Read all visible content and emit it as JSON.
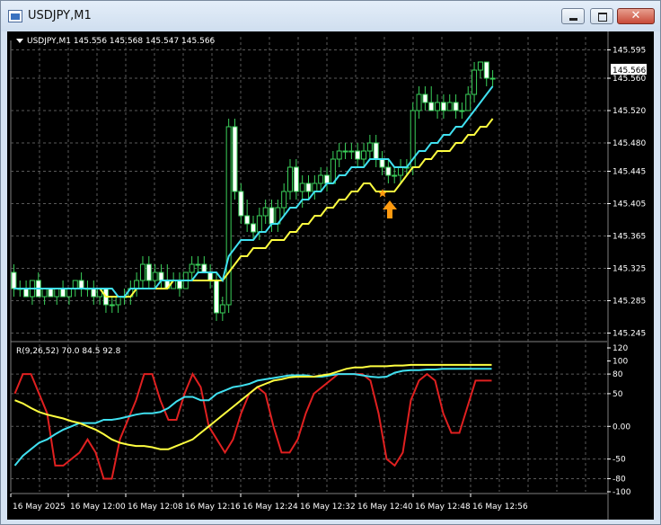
{
  "window": {
    "title": "USDJPY,M1"
  },
  "header": {
    "symbol_info": "USDJPY,M1  145.556 145.568 145.547 145.566"
  },
  "current_price_label": "145.566",
  "indicator_label": "R(9,26,52) 70.0 84.5 92.8",
  "colors": {
    "background": "#000000",
    "grid": "#5a5a5a",
    "candle_up": "#3ad05a",
    "candle_down": "#3ad05a",
    "ma_fast": "#40e0f0",
    "ma_slow": "#ffff40",
    "rsi_fast": "#e02020",
    "rsi_mid": "#40e0f0",
    "rsi_slow": "#ffff40",
    "signal_arrow": "#ff9a10"
  },
  "icons": [
    "app-icon",
    "minimize-icon",
    "maximize-icon",
    "close-icon",
    "dropdown-triangle-icon",
    "up-arrow-icon",
    "star-icon"
  ],
  "chart_data": [
    {
      "type": "candlestick",
      "title": "USDJPY,M1",
      "ylim": [
        145.24,
        145.6
      ],
      "y_ticks": [
        "145.595",
        "145.560",
        "145.520",
        "145.480",
        "145.445",
        "145.405",
        "145.365",
        "145.325",
        "145.285",
        "145.245"
      ],
      "x_labels": [
        "16 May 2025",
        "16 May 12:00",
        "16 May 12:08",
        "16 May 12:16",
        "16 May 12:24",
        "16 May 12:32",
        "16 May 12:40",
        "16 May 12:48",
        "16 May 12:56"
      ],
      "candles": [
        [
          145.32,
          145.33,
          145.29,
          145.3
        ],
        [
          145.3,
          145.31,
          145.29,
          145.3
        ],
        [
          145.3,
          145.31,
          145.29,
          145.29
        ],
        [
          145.29,
          145.31,
          145.28,
          145.31
        ],
        [
          145.31,
          145.32,
          145.29,
          145.29
        ],
        [
          145.29,
          145.3,
          145.28,
          145.3
        ],
        [
          145.3,
          145.3,
          145.29,
          145.29
        ],
        [
          145.29,
          145.3,
          145.28,
          145.3
        ],
        [
          145.3,
          145.31,
          145.29,
          145.29
        ],
        [
          145.29,
          145.3,
          145.28,
          145.3
        ],
        [
          145.3,
          145.31,
          145.29,
          145.31
        ],
        [
          145.31,
          145.32,
          145.29,
          145.3
        ],
        [
          145.3,
          145.31,
          145.29,
          145.3
        ],
        [
          145.3,
          145.31,
          145.28,
          145.29
        ],
        [
          145.29,
          145.3,
          145.28,
          145.3
        ],
        [
          145.3,
          145.3,
          145.27,
          145.28
        ],
        [
          145.28,
          145.29,
          145.27,
          145.28
        ],
        [
          145.28,
          145.29,
          145.27,
          145.29
        ],
        [
          145.29,
          145.3,
          145.28,
          145.29
        ],
        [
          145.29,
          145.31,
          145.28,
          145.3
        ],
        [
          145.3,
          145.32,
          145.29,
          145.31
        ],
        [
          145.31,
          145.34,
          145.3,
          145.33
        ],
        [
          145.33,
          145.34,
          145.3,
          145.31
        ],
        [
          145.31,
          145.33,
          145.3,
          145.32
        ],
        [
          145.32,
          145.33,
          145.3,
          145.31
        ],
        [
          145.31,
          145.33,
          145.3,
          145.3
        ],
        [
          145.3,
          145.32,
          145.3,
          145.31
        ],
        [
          145.31,
          145.32,
          145.29,
          145.3
        ],
        [
          145.3,
          145.32,
          145.3,
          145.32
        ],
        [
          145.32,
          145.34,
          145.31,
          145.33
        ],
        [
          145.33,
          145.34,
          145.32,
          145.33
        ],
        [
          145.33,
          145.34,
          145.32,
          145.32
        ],
        [
          145.32,
          145.33,
          145.3,
          145.31
        ],
        [
          145.31,
          145.32,
          145.26,
          145.27
        ],
        [
          145.27,
          145.29,
          145.26,
          145.28
        ],
        [
          145.28,
          145.51,
          145.27,
          145.5
        ],
        [
          145.5,
          145.51,
          145.41,
          145.42
        ],
        [
          145.42,
          145.43,
          145.38,
          145.39
        ],
        [
          145.39,
          145.41,
          145.37,
          145.38
        ],
        [
          145.38,
          145.39,
          145.36,
          145.37
        ],
        [
          145.37,
          145.4,
          145.36,
          145.39
        ],
        [
          145.39,
          145.41,
          145.38,
          145.4
        ],
        [
          145.4,
          145.41,
          145.37,
          145.38
        ],
        [
          145.38,
          145.41,
          145.37,
          145.4
        ],
        [
          145.4,
          145.43,
          145.39,
          145.42
        ],
        [
          145.42,
          145.46,
          145.41,
          145.45
        ],
        [
          145.45,
          145.46,
          145.41,
          145.42
        ],
        [
          145.42,
          145.44,
          145.4,
          145.43
        ],
        [
          145.43,
          145.44,
          145.41,
          145.42
        ],
        [
          145.42,
          145.44,
          145.41,
          145.43
        ],
        [
          145.43,
          145.45,
          145.42,
          145.44
        ],
        [
          145.44,
          145.45,
          145.42,
          145.43
        ],
        [
          145.43,
          145.47,
          145.43,
          145.46
        ],
        [
          145.46,
          145.48,
          145.45,
          145.47
        ],
        [
          145.47,
          145.48,
          145.46,
          145.47
        ],
        [
          145.47,
          145.48,
          145.46,
          145.47
        ],
        [
          145.47,
          145.48,
          145.45,
          145.46
        ],
        [
          145.46,
          145.48,
          145.45,
          145.47
        ],
        [
          145.47,
          145.49,
          145.46,
          145.48
        ],
        [
          145.48,
          145.49,
          145.45,
          145.46
        ],
        [
          145.46,
          145.47,
          145.44,
          145.45
        ],
        [
          145.45,
          145.46,
          145.43,
          145.44
        ],
        [
          145.44,
          145.45,
          145.43,
          145.44
        ],
        [
          145.44,
          145.46,
          145.43,
          145.45
        ],
        [
          145.45,
          145.46,
          145.44,
          145.45
        ],
        [
          145.45,
          145.53,
          145.44,
          145.52
        ],
        [
          145.52,
          145.55,
          145.51,
          145.54
        ],
        [
          145.54,
          145.55,
          145.52,
          145.53
        ],
        [
          145.53,
          145.55,
          145.52,
          145.52
        ],
        [
          145.52,
          145.54,
          145.51,
          145.53
        ],
        [
          145.53,
          145.54,
          145.51,
          145.52
        ],
        [
          145.52,
          145.54,
          145.52,
          145.53
        ],
        [
          145.53,
          145.54,
          145.51,
          145.52
        ],
        [
          145.52,
          145.53,
          145.51,
          145.52
        ],
        [
          145.52,
          145.55,
          145.52,
          145.54
        ],
        [
          145.54,
          145.58,
          145.53,
          145.57
        ],
        [
          145.57,
          145.58,
          145.56,
          145.58
        ],
        [
          145.58,
          145.58,
          145.55,
          145.56
        ],
        [
          145.56,
          145.57,
          145.55,
          145.56
        ]
      ],
      "ma_fast": [
        145.3,
        145.3,
        145.3,
        145.3,
        145.3,
        145.3,
        145.3,
        145.3,
        145.3,
        145.3,
        145.3,
        145.3,
        145.3,
        145.3,
        145.3,
        145.3,
        145.3,
        145.29,
        145.29,
        145.3,
        145.3,
        145.3,
        145.3,
        145.3,
        145.31,
        145.31,
        145.31,
        145.31,
        145.31,
        145.31,
        145.32,
        145.32,
        145.32,
        145.32,
        145.31,
        145.34,
        145.35,
        145.36,
        145.36,
        145.36,
        145.37,
        145.37,
        145.38,
        145.38,
        145.39,
        145.4,
        145.4,
        145.41,
        145.41,
        145.42,
        145.42,
        145.43,
        145.43,
        145.44,
        145.44,
        145.45,
        145.45,
        145.45,
        145.46,
        145.46,
        145.46,
        145.46,
        145.45,
        145.45,
        145.45,
        145.46,
        145.47,
        145.47,
        145.48,
        145.48,
        145.49,
        145.49,
        145.5,
        145.5,
        145.51,
        145.52,
        145.53,
        145.54,
        145.55
      ],
      "ma_slow": [
        145.3,
        145.3,
        145.3,
        145.3,
        145.3,
        145.3,
        145.3,
        145.3,
        145.3,
        145.3,
        145.3,
        145.3,
        145.3,
        145.3,
        145.3,
        145.29,
        145.29,
        145.29,
        145.29,
        145.29,
        145.3,
        145.3,
        145.3,
        145.3,
        145.3,
        145.3,
        145.31,
        145.31,
        145.31,
        145.31,
        145.31,
        145.31,
        145.31,
        145.31,
        145.31,
        145.32,
        145.33,
        145.34,
        145.34,
        145.35,
        145.35,
        145.35,
        145.36,
        145.36,
        145.36,
        145.37,
        145.37,
        145.38,
        145.38,
        145.39,
        145.39,
        145.4,
        145.4,
        145.41,
        145.41,
        145.42,
        145.42,
        145.43,
        145.43,
        145.42,
        145.42,
        145.42,
        145.42,
        145.43,
        145.44,
        145.45,
        145.45,
        145.46,
        145.46,
        145.47,
        145.47,
        145.47,
        145.48,
        145.48,
        145.49,
        145.49,
        145.5,
        145.5,
        145.51
      ]
    },
    {
      "type": "line",
      "title": "R(9,26,52) 70.0 84.5 92.8",
      "ylim": [
        -100,
        120
      ],
      "y_ticks": [
        "120",
        "100",
        "80",
        "50",
        "0.00",
        "-50",
        "-80",
        "-100"
      ],
      "series": [
        {
          "name": "R(9)",
          "values": [
            50,
            80,
            80,
            50,
            20,
            -60,
            -60,
            -50,
            -40,
            -20,
            -40,
            -80,
            -80,
            -20,
            10,
            40,
            80,
            80,
            40,
            10,
            10,
            50,
            80,
            60,
            0,
            -20,
            -40,
            -20,
            20,
            50,
            60,
            50,
            0,
            -40,
            -40,
            -20,
            20,
            50,
            60,
            70,
            80,
            80,
            80,
            80,
            70,
            20,
            -50,
            -60,
            -40,
            40,
            70,
            80,
            70,
            20,
            -10,
            -10,
            30,
            70,
            70,
            70
          ]
        },
        {
          "name": "R(26)",
          "values": [
            -60,
            -45,
            -35,
            -25,
            -20,
            -12,
            -5,
            0,
            5,
            5,
            5,
            10,
            10,
            12,
            15,
            18,
            20,
            20,
            22,
            28,
            38,
            45,
            45,
            40,
            40,
            50,
            55,
            60,
            62,
            65,
            70,
            72,
            74,
            76,
            78,
            78,
            78,
            76,
            76,
            78,
            80,
            80,
            80,
            78,
            76,
            75,
            76,
            82,
            85,
            86,
            86,
            87,
            87,
            88,
            88,
            88,
            88,
            88,
            88,
            88
          ]
        },
        {
          "name": "R(52)",
          "values": [
            40,
            35,
            28,
            22,
            18,
            15,
            12,
            8,
            5,
            0,
            -5,
            -12,
            -20,
            -25,
            -28,
            -30,
            -30,
            -32,
            -35,
            -35,
            -30,
            -25,
            -20,
            -10,
            0,
            10,
            20,
            30,
            40,
            50,
            60,
            65,
            70,
            72,
            75,
            76,
            76,
            76,
            78,
            80,
            84,
            88,
            90,
            90,
            92,
            92,
            92,
            93,
            93,
            94,
            94,
            94,
            94,
            94,
            94,
            94,
            94,
            94,
            94,
            94
          ]
        }
      ]
    }
  ]
}
